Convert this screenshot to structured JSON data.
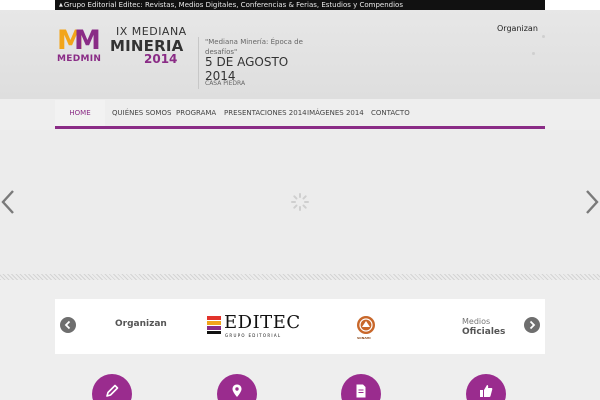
{
  "topbar": {
    "text": "Grupo Editorial Editec: Revistas, Medios Digitales, Conferencias & Ferias, Estudios y Compendios"
  },
  "logo": {
    "mark": "MM",
    "medmin": "MEDMIN",
    "edition": "IX MEDIANA",
    "name": "MINERIA",
    "year": "2014"
  },
  "event": {
    "tagline": "\"Mediana Minería: Época de desafíos\"",
    "date": "5 DE AGOSTO 2014",
    "venue": "CASA PIEDRA"
  },
  "header": {
    "organizan": "Organizan"
  },
  "nav": {
    "items": [
      {
        "label": "HOME"
      },
      {
        "label": "QUIÉNES SOMOS"
      },
      {
        "label": "PROGRAMA"
      },
      {
        "label": "PRESENTACIONES 2014"
      },
      {
        "label": "IMÁGENES 2014"
      },
      {
        "label": "CONTACTO"
      }
    ]
  },
  "partners": {
    "organizan_label": "Organizan",
    "editec_name": "EDITEC",
    "editec_sub": "GRUPO EDITORIAL",
    "sonami_name": "SONAMI",
    "medios_line1": "Medios",
    "medios_line2": "Oficiales"
  },
  "colors": {
    "brand": "#8a2c86",
    "accent_orange": "#f2a51a",
    "feature_circle": "#9a2c8e"
  },
  "icons": {
    "slider_prev": "chevron-left-icon",
    "slider_next": "chevron-right-icon",
    "loader": "spinner-icon",
    "features": [
      "pencil-icon",
      "map-pin-icon",
      "document-icon",
      "thumbs-up-icon"
    ]
  }
}
